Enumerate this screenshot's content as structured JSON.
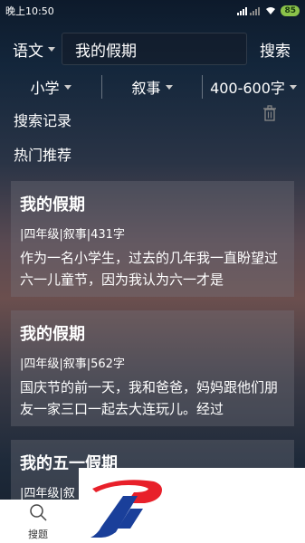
{
  "status": {
    "time": "晚上10:50",
    "battery": "85"
  },
  "topbar": {
    "subject": "语文",
    "search_value": "我的假期",
    "search_button": "搜索"
  },
  "filters": [
    {
      "label": "小学"
    },
    {
      "label": "叙事"
    },
    {
      "label": "400-600字"
    }
  ],
  "history": {
    "title": "搜索记录"
  },
  "hot": {
    "title": "热门推荐"
  },
  "cards": [
    {
      "title": "我的假期",
      "meta": "|四年级|叙事|431字",
      "excerpt": "作为一名小学生，过去的几年我一直盼望过六一儿童节，因为我认为六一才是"
    },
    {
      "title": "我的假期",
      "meta": "|四年级|叙事|562字",
      "excerpt": "国庆节的前一天，我和爸爸，妈妈跟他们朋友一家三口一起去大连玩儿。经过"
    },
    {
      "title": "我的五一假期",
      "meta": "|四年级|叙",
      "excerpt": ""
    }
  ],
  "nav": {
    "search_label": "搜题"
  },
  "colors": {
    "logo_red": "#e8202a",
    "logo_blue": "#1a3f9a",
    "battery": "#8bc34a"
  }
}
